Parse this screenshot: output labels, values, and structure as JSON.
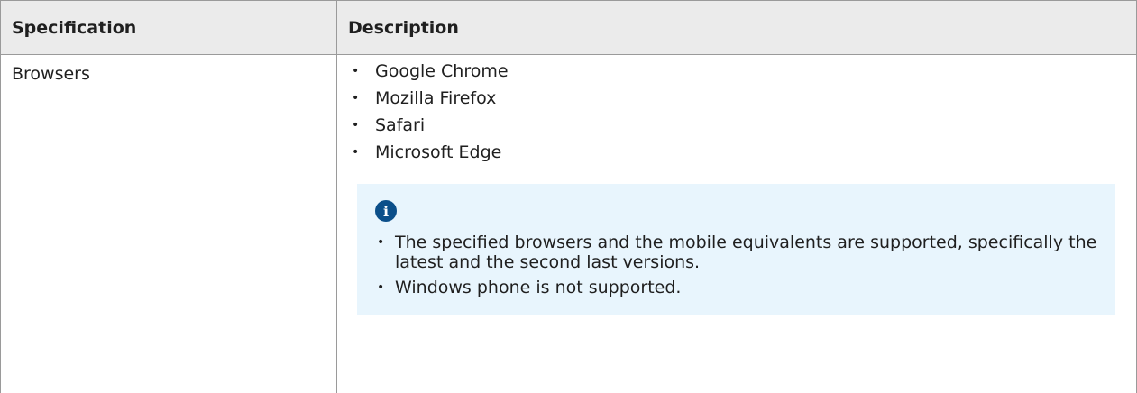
{
  "table": {
    "headers": {
      "specification": "Specification",
      "description": "Description"
    },
    "rows": [
      {
        "specification": "Browsers",
        "browsers": [
          "Google Chrome",
          "Mozilla Firefox",
          "Safari",
          "Microsoft Edge"
        ],
        "note": {
          "icon": "info-icon",
          "items": [
            "The specified browsers and the mobile equivalents are supported, specifically the latest and the second last versions.",
            "Windows phone is not supported."
          ]
        }
      }
    ]
  },
  "bullet_glyph": "•",
  "colors": {
    "header_bg": "#ebebeb",
    "border": "#9a9a9a",
    "note_bg": "#e8f5fd",
    "info_icon": "#0b4f8a"
  }
}
